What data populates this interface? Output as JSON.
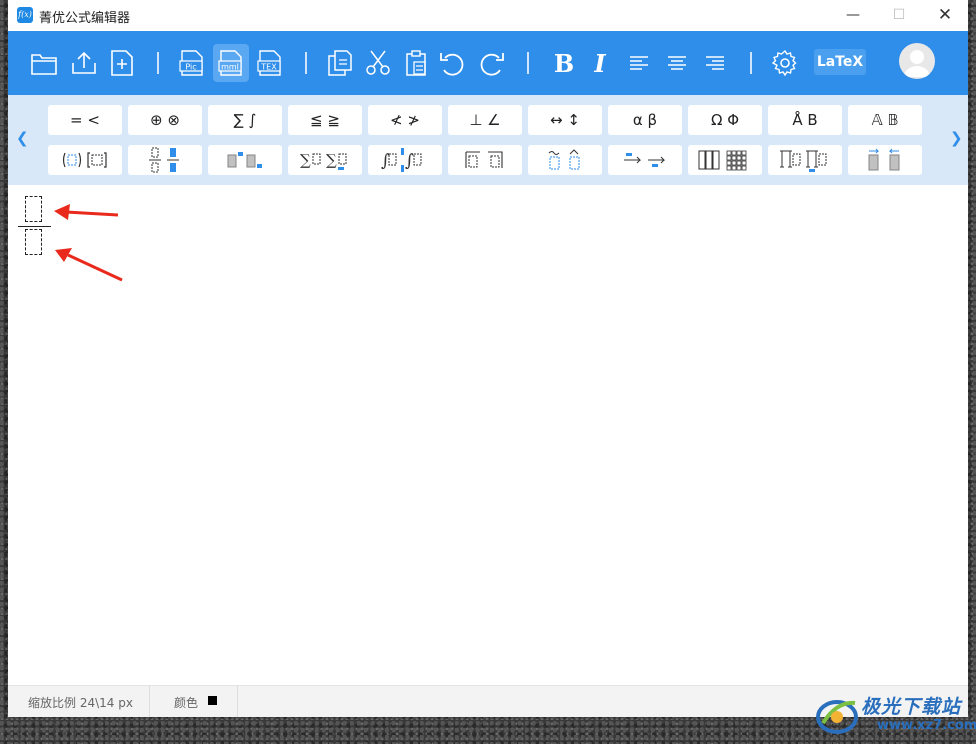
{
  "window": {
    "title": "菁优公式编辑器",
    "logo_text": "f(x)",
    "controls": {
      "minimize": "—",
      "maximize": "☐",
      "close": "✕"
    }
  },
  "toolbar": {
    "bold_label": "B",
    "italic_label": "I",
    "latex_label": "LaTeX",
    "export_labels": {
      "pic": "Pic",
      "mml": "mml",
      "tex": "TEX"
    },
    "accent_color": "#2f8ee9",
    "active_item": "mml"
  },
  "palette": {
    "row1": [
      "= <",
      "⊕ ⊗",
      "∑ ∫",
      "≦ ≧",
      "≮ ≯",
      "⊥ ∠",
      "↔ ↕",
      "α β",
      "Ω Φ",
      "Å B",
      "𝔸 𝔹"
    ],
    "left_arrow": "❮",
    "right_arrow": "❯"
  },
  "status": {
    "zoom": "缩放比例 24\\14 px",
    "color_label": "颜色",
    "color_value": "#000000"
  },
  "watermark": {
    "text": "极光下载站",
    "url": "www.xz7.com"
  }
}
